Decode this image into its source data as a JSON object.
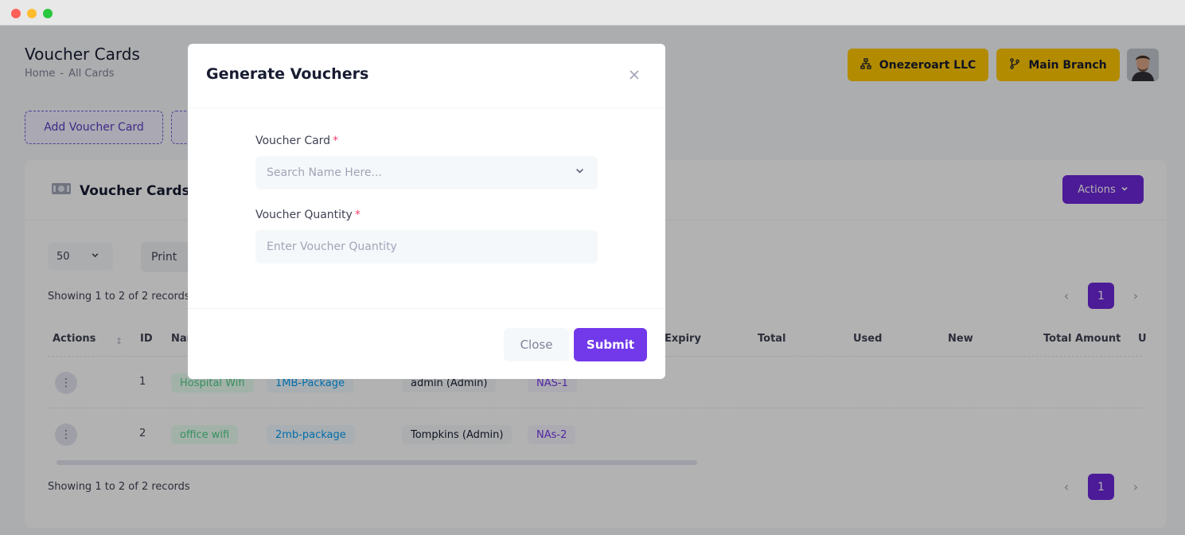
{
  "page": {
    "title": "Voucher Cards",
    "breadcrumbs": [
      "Home",
      "-",
      "All Cards"
    ]
  },
  "header": {
    "org_button": "Onezeroart LLC",
    "branch_button": "Main Branch"
  },
  "toolbar": {
    "add_voucher_card": "Add Voucher Card"
  },
  "card": {
    "title": "Voucher Cards",
    "actions_label": "Actions",
    "page_size": "50",
    "print_label": "Print",
    "showing_top": "Showing 1 to 2 of 2 records",
    "showing_bottom": "Showing 1 to 2 of 2 records",
    "current_page": "1"
  },
  "table": {
    "columns": [
      "Actions",
      "ID",
      "Nar",
      "Expiry",
      "Total",
      "Used",
      "New",
      "Total Amount",
      "U"
    ],
    "rows": [
      {
        "id": "1",
        "name": "Hospital Wifi",
        "package": "1MB-Package",
        "owner": "admin (Admin)",
        "nas": "NAS-1"
      },
      {
        "id": "2",
        "name": "office wifi",
        "package": "2mb-package",
        "owner": "Tompkins (Admin)",
        "nas": "NAs-2"
      }
    ]
  },
  "modal": {
    "title": "Generate Vouchers",
    "voucher_card_label": "Voucher Card",
    "voucher_card_placeholder": "Search Name Here...",
    "quantity_label": "Voucher Quantity",
    "quantity_placeholder": "Enter Voucher Quantity",
    "required_mark": "*",
    "close_label": "Close",
    "submit_label": "Submit"
  },
  "colors": {
    "primary": "#6d28d9",
    "accent_yellow": "#ffc700",
    "required": "#f1416c"
  }
}
